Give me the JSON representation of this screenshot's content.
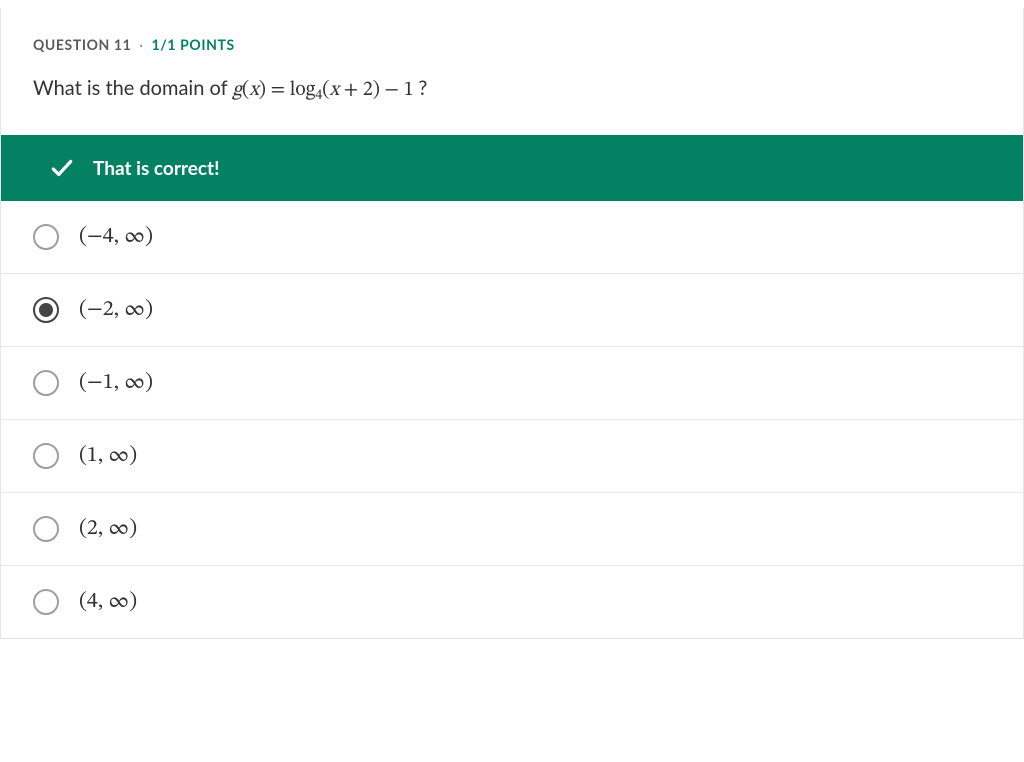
{
  "question": {
    "number_label": "QUESTION 11",
    "separator": "·",
    "points": "1/1 POINTS",
    "prompt_prefix": "What is the domain of ",
    "prompt_math": "g(x) = log₄(x + 2) − 1",
    "prompt_suffix": "?"
  },
  "banner": {
    "text": "That is correct!"
  },
  "options": [
    {
      "label": "(−4, ∞)",
      "selected": false
    },
    {
      "label": "(−2, ∞)",
      "selected": true
    },
    {
      "label": "(−1, ∞)",
      "selected": false
    },
    {
      "label": "(1, ∞)",
      "selected": false
    },
    {
      "label": "(2, ∞)",
      "selected": false
    },
    {
      "label": "(4, ∞)",
      "selected": false
    }
  ]
}
